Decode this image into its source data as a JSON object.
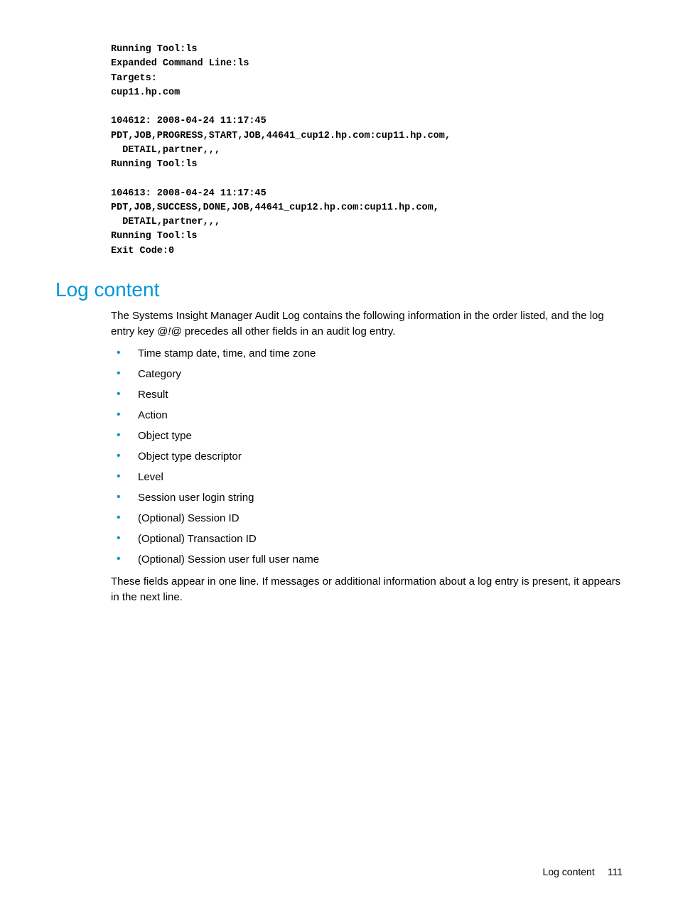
{
  "code": "Running Tool:ls\nExpanded Command Line:ls\nTargets:\ncup11.hp.com\n\n104612: 2008-04-24 11:17:45\nPDT,JOB,PROGRESS,START,JOB,44641_cup12.hp.com:cup11.hp.com,\n  DETAIL,partner,,,\nRunning Tool:ls\n\n104613: 2008-04-24 11:17:45\nPDT,JOB,SUCCESS,DONE,JOB,44641_cup12.hp.com:cup11.hp.com,\n  DETAIL,partner,,,\nRunning Tool:ls\nExit Code:0",
  "heading": "Log content",
  "intro_before": "The Systems Insight Manager Audit Log contains the following information in the order listed, and the log entry key ",
  "intro_key": "@!@",
  "intro_after": " precedes all other fields in an audit log entry.",
  "bullets": [
    "Time stamp date, time, and time zone",
    "Category",
    "Result",
    "Action",
    "Object type",
    "Object type descriptor",
    "Level",
    "Session user login string",
    "(Optional) Session ID",
    "(Optional) Transaction ID",
    "(Optional) Session user full user name"
  ],
  "outro": "These fields appear in one line. If messages or additional information about a log entry is present, it appears in the next line.",
  "footer": {
    "label": "Log content",
    "page": "111"
  }
}
